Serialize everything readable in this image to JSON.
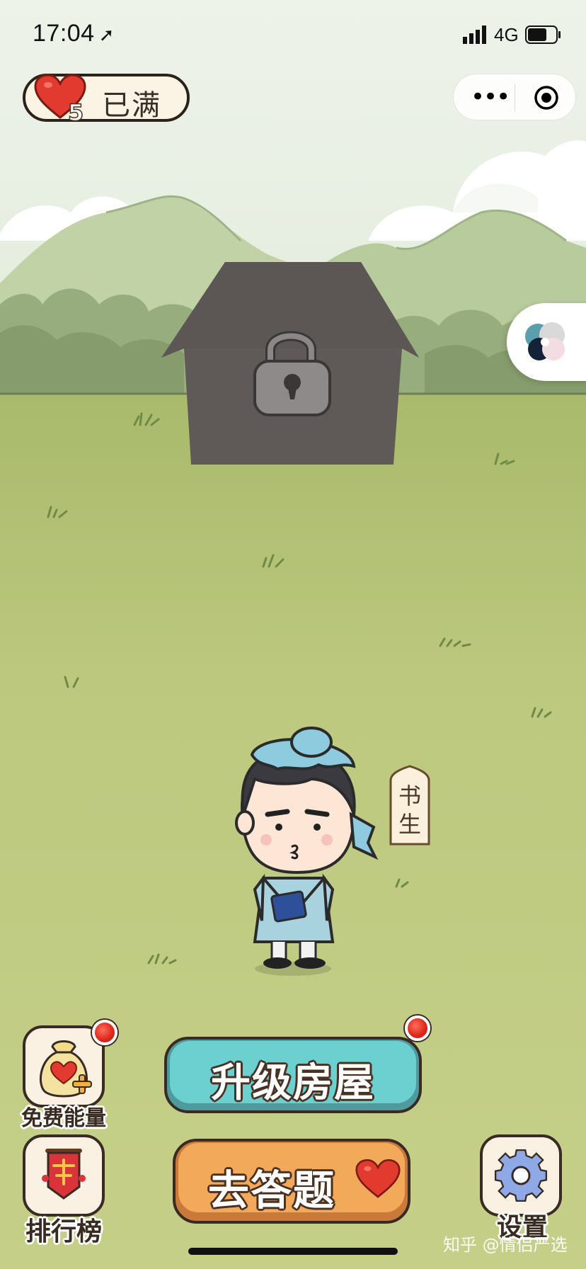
{
  "status_bar": {
    "time": "17:04",
    "network": "4G"
  },
  "energy": {
    "count": "5",
    "status": "已满"
  },
  "character": {
    "title": "书生",
    "title_chars": [
      "书",
      "生"
    ]
  },
  "buttons": {
    "free_energy": "免费能量",
    "leaderboard": "排行榜",
    "upgrade_house": "升级房屋",
    "answer": "去答题",
    "settings": "设置"
  },
  "watermark": "知乎 @情侣严选",
  "icons": {
    "location": "location-arrow-icon",
    "signal": "signal-icon",
    "battery": "battery-icon",
    "energy": "heart-icon",
    "more": "more-icon",
    "close": "target-icon",
    "lock": "lock-icon",
    "free_energy": "money-bag-icon",
    "leaderboard": "banner-icon",
    "settings": "gear-icon"
  },
  "colors": {
    "sky": "#e7efe2",
    "grass": "#c3cd84",
    "house": "#5f5a58",
    "upgrade_button": "#6ccfd0",
    "answer_button": "#f3a95a",
    "heart": "#e23a2e",
    "badge": "#e02a1c"
  }
}
